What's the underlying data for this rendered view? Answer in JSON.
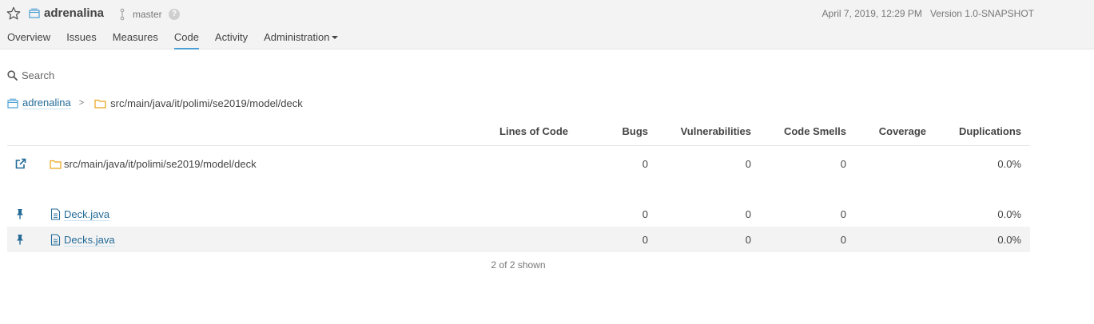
{
  "header": {
    "project_name": "adrenalina",
    "branch": "master",
    "help_glyph": "?",
    "date": "April 7, 2019, 12:29 PM",
    "version": "Version 1.0-SNAPSHOT"
  },
  "nav": {
    "overview": "Overview",
    "issues": "Issues",
    "measures": "Measures",
    "code": "Code",
    "activity": "Activity",
    "administration": "Administration",
    "active": "Code"
  },
  "search": {
    "placeholder": "Search",
    "value": ""
  },
  "breadcrumb": {
    "project": "adrenalina",
    "separator": ">",
    "path": "src/main/java/it/polimi/se2019/model/deck"
  },
  "table": {
    "columns": {
      "loc": "Lines of Code",
      "bugs": "Bugs",
      "vulnerabilities": "Vulnerabilities",
      "code_smells": "Code Smells",
      "coverage": "Coverage",
      "duplications": "Duplications"
    },
    "base_row": {
      "name": "src/main/java/it/polimi/se2019/model/deck",
      "icon": "external-link-icon",
      "loc": "",
      "bugs": "0",
      "vulnerabilities": "0",
      "code_smells": "0",
      "coverage": "",
      "duplications": "0.0%"
    },
    "rows": [
      {
        "name": "Deck.java",
        "icon": "pin-icon",
        "loc": "",
        "bugs": "0",
        "vulnerabilities": "0",
        "code_smells": "0",
        "coverage": "",
        "duplications": "0.0%"
      },
      {
        "name": "Decks.java",
        "icon": "pin-icon",
        "loc": "",
        "bugs": "0",
        "vulnerabilities": "0",
        "code_smells": "0",
        "coverage": "",
        "duplications": "0.0%"
      }
    ]
  },
  "footer": {
    "shown": "2 of 2 shown"
  },
  "colors": {
    "link": "#236a97",
    "accent": "#4b9fd5",
    "folder": "#e8a317",
    "icon": "#236a97"
  }
}
